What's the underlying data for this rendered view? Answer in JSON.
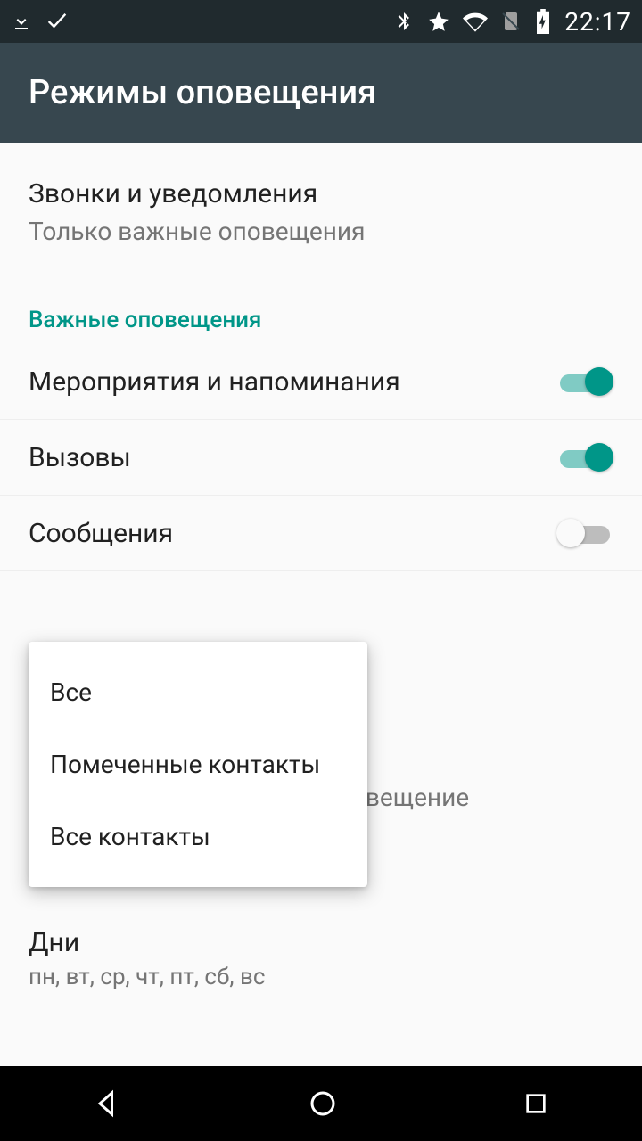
{
  "statusbar": {
    "time": "22:17"
  },
  "appbar": {
    "title": "Режимы оповещения"
  },
  "first_item": {
    "title": "Звонки и уведомления",
    "subtitle": "Только важные оповещения"
  },
  "section_header": "Важные оповещения",
  "toggles": {
    "events": {
      "label": "Мероприятия и напоминания",
      "on": true
    },
    "calls": {
      "label": "Вызовы",
      "on": true
    },
    "messages": {
      "label": "Сообщения",
      "on": false
    }
  },
  "popup": {
    "options": [
      "Все",
      "Помеченные контакты",
      "Все контакты"
    ]
  },
  "behind_fragment": "е оповещение",
  "days": {
    "title": "Дни",
    "subtitle": "пн, вт, ср, чт, пт, сб, вс"
  }
}
